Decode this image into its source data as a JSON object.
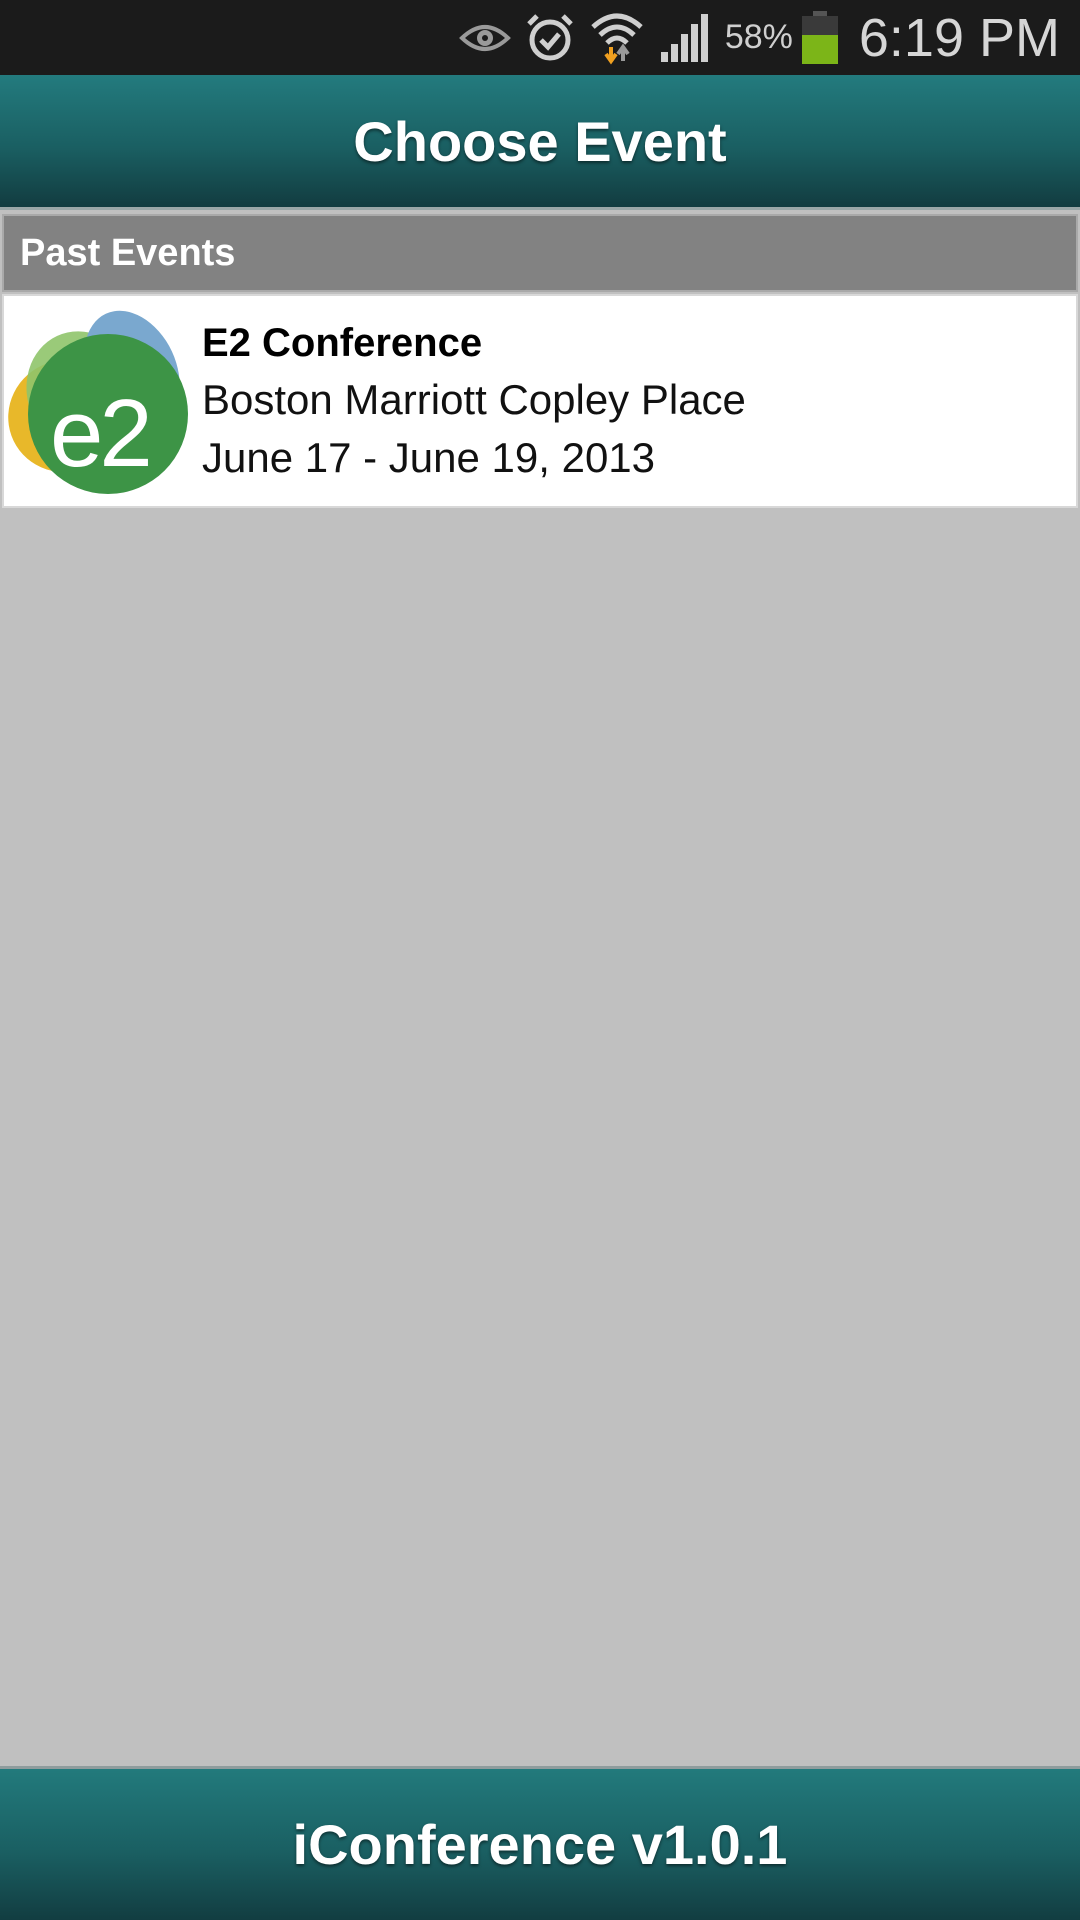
{
  "status_bar": {
    "icons": [
      "eye-icon",
      "alarm-icon",
      "wifi-icon",
      "signal-icon",
      "battery-icon"
    ],
    "battery_percent": "58%",
    "time": "6:19 PM",
    "battery_color": "#7cb518"
  },
  "header": {
    "title": "Choose Event"
  },
  "sections": [
    {
      "title": "Past Events",
      "events": [
        {
          "name": "E2 Conference",
          "venue": "Boston Marriott Copley Place",
          "dates": "June 17 - June 19, 2013",
          "logo": "e2-logo"
        }
      ]
    }
  ],
  "footer": {
    "text": "iConference v1.0.1"
  },
  "colors": {
    "header_teal": "#1a5f62",
    "section_gray": "#828282",
    "background": "#c0c0c0"
  }
}
